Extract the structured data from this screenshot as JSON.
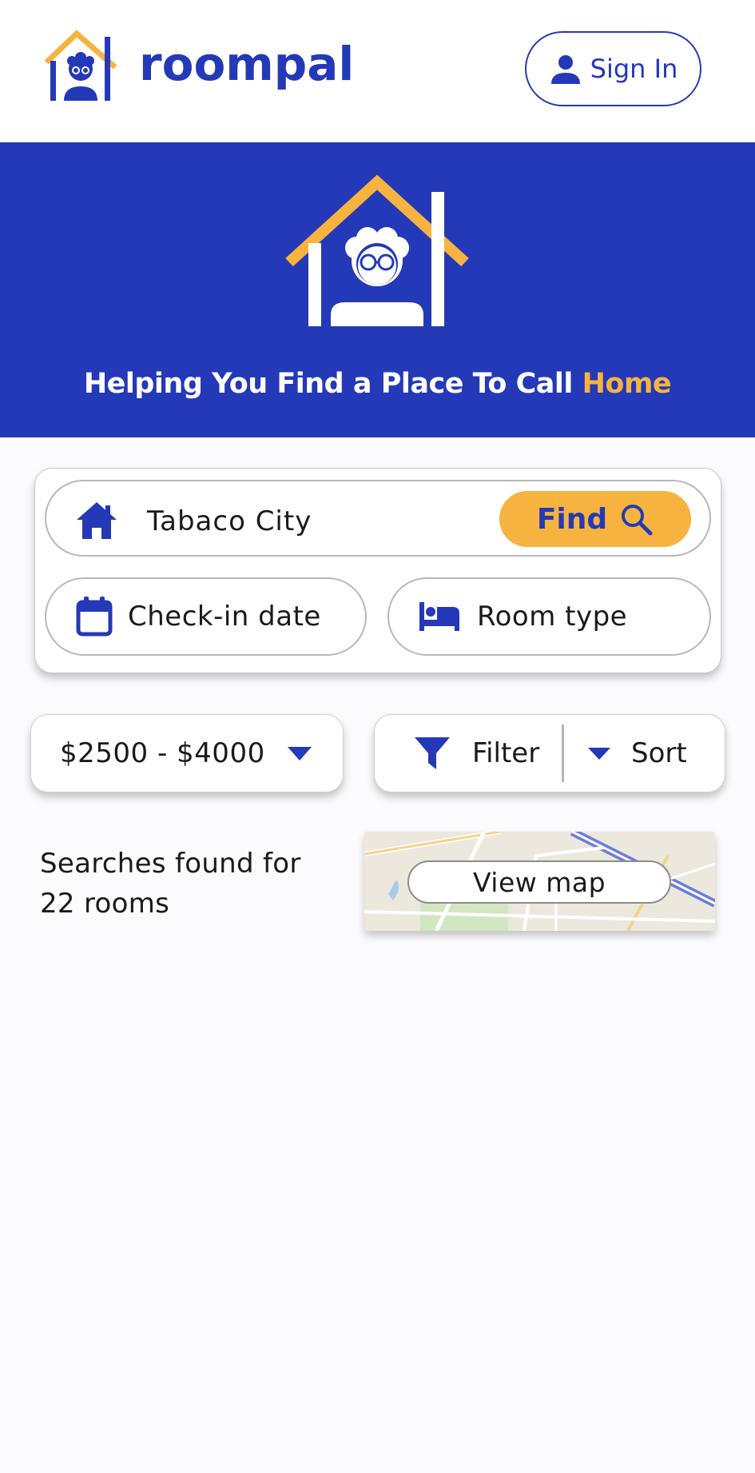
{
  "header": {
    "brand_name": "roompal",
    "signin_label": "Sign In"
  },
  "hero": {
    "tagline_main": "Helping You Find a Place To Call ",
    "tagline_accent": "Home"
  },
  "search": {
    "location_value": "Tabaco City",
    "find_label": "Find",
    "checkin_label": "Check-in date",
    "room_type_label": "Room type"
  },
  "filters": {
    "price_range": "$2500 - $4000",
    "filter_label": "Filter",
    "sort_label": "Sort"
  },
  "results": {
    "line1": "Searches found for",
    "line2": "22 rooms",
    "view_map_label": "View map"
  },
  "colors": {
    "brand_blue": "#2439b8",
    "accent_yellow": "#f6b33f",
    "background": "#fbfbfd"
  },
  "icons": {
    "logo": "house-person-logo-icon",
    "signin": "user-icon",
    "location": "home-icon",
    "find": "search-icon",
    "checkin": "calendar-icon",
    "room_type": "bed-icon",
    "price": "chevron-down-icon",
    "filter": "filter-funnel-icon",
    "sort": "chevron-down-icon"
  }
}
